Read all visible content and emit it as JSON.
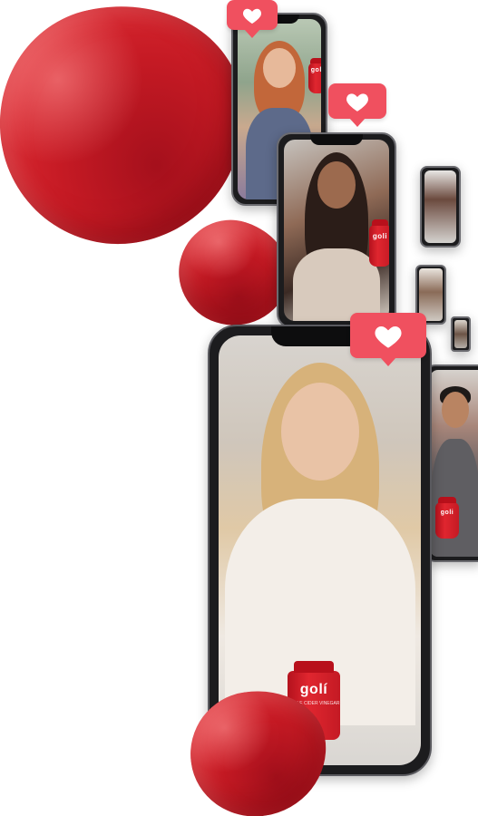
{
  "brand": {
    "bottle_label": "golí",
    "bottle_small_label": "goli",
    "bottle_subtext": "APPLE CIDER VINEGAR",
    "accent_color": "#f0505f",
    "gummy_color": "#c81a24"
  },
  "like_icons": [
    {
      "icon": "heart-icon"
    },
    {
      "icon": "heart-icon"
    },
    {
      "icon": "heart-icon"
    }
  ]
}
